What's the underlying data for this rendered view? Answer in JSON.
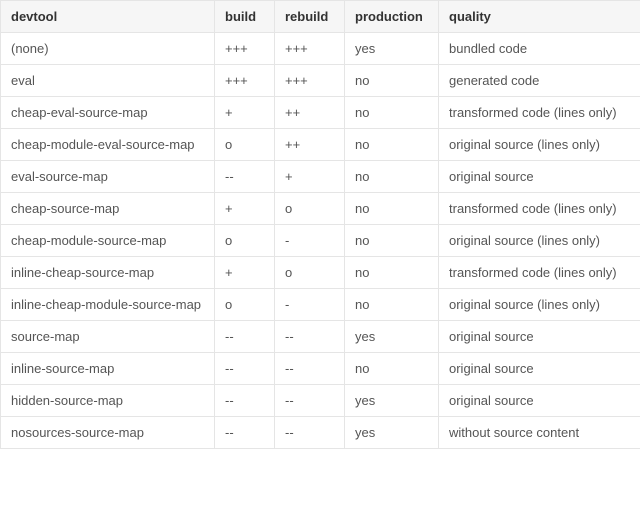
{
  "headers": {
    "devtool": "devtool",
    "build": "build",
    "rebuild": "rebuild",
    "production": "production",
    "quality": "quality"
  },
  "rows": [
    {
      "devtool": "(none)",
      "build": "+++",
      "rebuild": "+++",
      "production": "yes",
      "quality": "bundled code"
    },
    {
      "devtool": "eval",
      "build": "+++",
      "rebuild": "+++",
      "production": "no",
      "quality": "generated code"
    },
    {
      "devtool": "cheap-eval-source-map",
      "build": "+",
      "rebuild": "++",
      "production": "no",
      "quality": "transformed code (lines only)"
    },
    {
      "devtool": "cheap-module-eval-source-map",
      "build": "o",
      "rebuild": "++",
      "production": "no",
      "quality": "original source (lines only)"
    },
    {
      "devtool": "eval-source-map",
      "build": "--",
      "rebuild": "+",
      "production": "no",
      "quality": "original source"
    },
    {
      "devtool": "cheap-source-map",
      "build": "+",
      "rebuild": "o",
      "production": "no",
      "quality": "transformed code (lines only)"
    },
    {
      "devtool": "cheap-module-source-map",
      "build": "o",
      "rebuild": "-",
      "production": "no",
      "quality": "original source (lines only)"
    },
    {
      "devtool": "inline-cheap-source-map",
      "build": "+",
      "rebuild": "o",
      "production": "no",
      "quality": "transformed code (lines only)"
    },
    {
      "devtool": "inline-cheap-module-source-map",
      "build": "o",
      "rebuild": "-",
      "production": "no",
      "quality": "original source (lines only)"
    },
    {
      "devtool": "source-map",
      "build": "--",
      "rebuild": "--",
      "production": "yes",
      "quality": "original source"
    },
    {
      "devtool": "inline-source-map",
      "build": "--",
      "rebuild": "--",
      "production": "no",
      "quality": "original source"
    },
    {
      "devtool": "hidden-source-map",
      "build": "--",
      "rebuild": "--",
      "production": "yes",
      "quality": "original source"
    },
    {
      "devtool": "nosources-source-map",
      "build": "--",
      "rebuild": "--",
      "production": "yes",
      "quality": "without source content"
    }
  ]
}
